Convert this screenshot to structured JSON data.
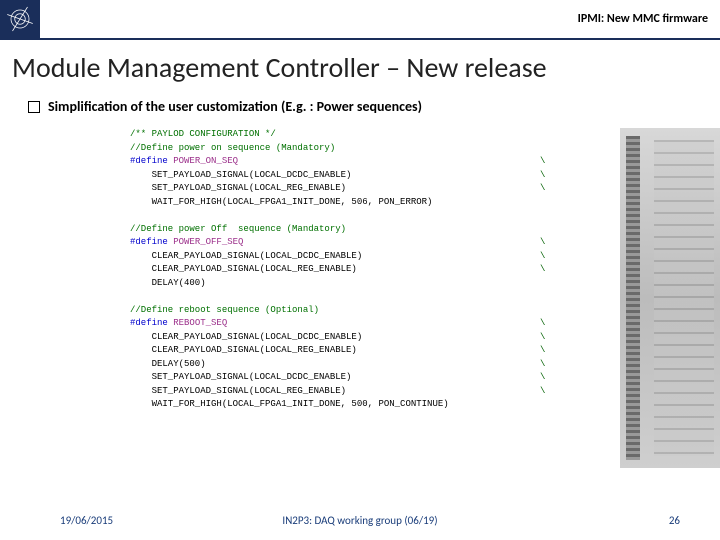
{
  "header": {
    "title": "IPMI: New MMC firmware"
  },
  "title": "Module Management Controller – New release",
  "bullet": "Simplification of the user customization (E.g. : Power sequences)",
  "code": [
    {
      "cls": "c-green",
      "text": "/** PAYLOD CONFIGURATION */"
    },
    {
      "cls": "c-green",
      "text": "//Define power on sequence (Mandatory)"
    },
    {
      "cls": "c-blue",
      "text": "#define",
      "after": " POWER_ON_SEQ",
      "afterCls": "c-mag",
      "cont": true
    },
    {
      "cls": "c-black",
      "text": "    SET_PAYLOAD_SIGNAL(LOCAL_DCDC_ENABLE)",
      "cont": true
    },
    {
      "cls": "c-black",
      "text": "    SET_PAYLOAD_SIGNAL(LOCAL_REG_ENABLE)",
      "cont": true
    },
    {
      "cls": "c-black",
      "text": "    WAIT_FOR_HIGH(LOCAL_FPGA1_INIT_DONE, 506, PON_ERROR)"
    },
    {
      "cls": "c-black",
      "text": " "
    },
    {
      "cls": "c-green",
      "text": "//Define power Off  sequence (Mandatory)"
    },
    {
      "cls": "c-blue",
      "text": "#define",
      "after": " POWER_OFF_SEQ",
      "afterCls": "c-mag",
      "cont": true
    },
    {
      "cls": "c-black",
      "text": "    CLEAR_PAYLOAD_SIGNAL(LOCAL_DCDC_ENABLE)",
      "cont": true
    },
    {
      "cls": "c-black",
      "text": "    CLEAR_PAYLOAD_SIGNAL(LOCAL_REG_ENABLE)",
      "cont": true
    },
    {
      "cls": "c-black",
      "text": "    DELAY(400)"
    },
    {
      "cls": "c-black",
      "text": " "
    },
    {
      "cls": "c-green",
      "text": "//Define reboot sequence (Optional)"
    },
    {
      "cls": "c-blue",
      "text": "#define",
      "after": " REBOOT_SEQ",
      "afterCls": "c-mag",
      "cont": true
    },
    {
      "cls": "c-black",
      "text": "    CLEAR_PAYLOAD_SIGNAL(LOCAL_DCDC_ENABLE)",
      "cont": true
    },
    {
      "cls": "c-black",
      "text": "    CLEAR_PAYLOAD_SIGNAL(LOCAL_REG_ENABLE)",
      "cont": true
    },
    {
      "cls": "c-black",
      "text": "    DELAY(500)",
      "cont": true
    },
    {
      "cls": "c-black",
      "text": "    SET_PAYLOAD_SIGNAL(LOCAL_DCDC_ENABLE)",
      "cont": true
    },
    {
      "cls": "c-black",
      "text": "    SET_PAYLOAD_SIGNAL(LOCAL_REG_ENABLE)",
      "cont": true
    },
    {
      "cls": "c-black",
      "text": "    WAIT_FOR_HIGH(LOCAL_FPGA1_INIT_DONE, 500, PON_CONTINUE)"
    }
  ],
  "footer": {
    "date": "19/06/2015",
    "center": "IN2P3: DAQ working group (06/19)",
    "page": "26"
  }
}
